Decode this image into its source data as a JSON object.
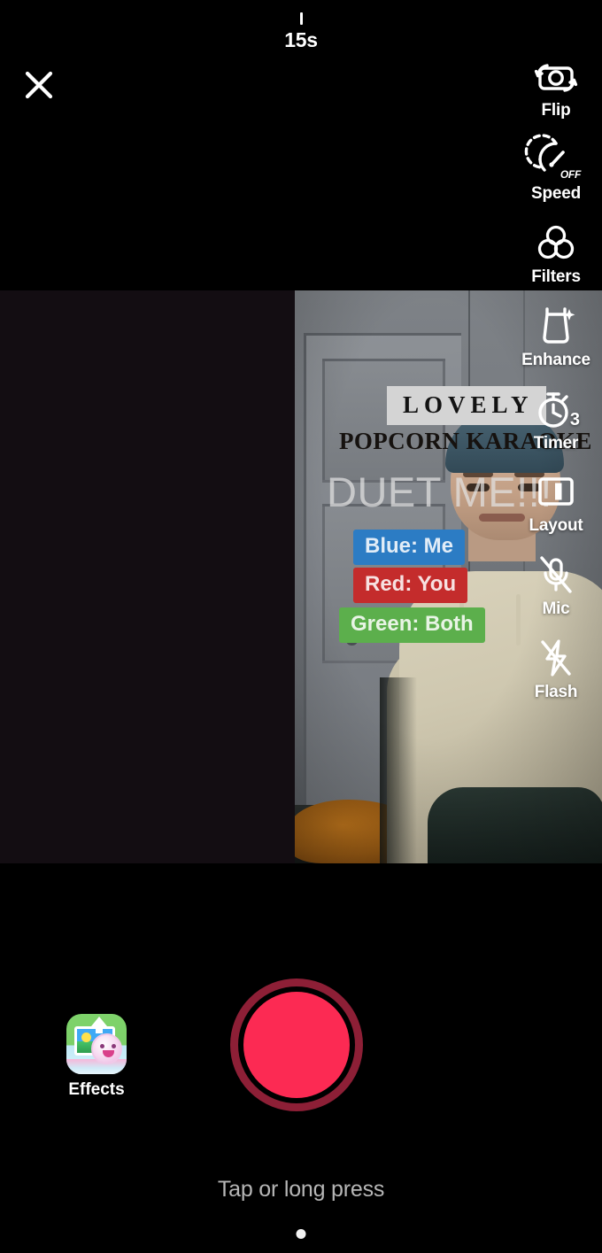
{
  "app": {
    "screen_name": "TikTok Camera - Duet Recording",
    "background_color": "#000000",
    "accent_color": "#fc2a53"
  },
  "top_bar": {
    "close_icon": "close-icon",
    "duration": {
      "label": "15s",
      "tick_marker": "|"
    }
  },
  "duet": {
    "left_panel": {
      "state": "empty",
      "background_color": "#130d12"
    },
    "right_panel": {
      "description": "Video preview of person in beige hoodie and blue beanie sitting in front of a white door",
      "overlays": [
        {
          "id": "lovely",
          "text": "LOVELY",
          "style": "serif-banner",
          "bg_color": "#d4d4d4",
          "text_color": "#121212"
        },
        {
          "id": "popcorn-karaoke",
          "text": "POPCORN KARAOKE",
          "style": "serif-heading",
          "text_color": "#16120f"
        },
        {
          "id": "duet-me",
          "text": "DUET ME!!!",
          "style": "large-outline",
          "text_color": "#e2e2e2"
        },
        {
          "id": "chip-blue",
          "text": "Blue: Me",
          "bg_color": "#2c7cc4",
          "text_color": "#ffffff"
        },
        {
          "id": "chip-red",
          "text": "Red: You",
          "bg_color": "#c42c2c",
          "text_color": "#ffffff"
        },
        {
          "id": "chip-green",
          "text": "Green: Both",
          "bg_color": "#5caf4c",
          "text_color": "#ffffff"
        }
      ]
    }
  },
  "tools": [
    {
      "id": "flip",
      "label": "Flip",
      "icon": "camera-flip-icon",
      "badge": ""
    },
    {
      "id": "speed",
      "label": "Speed",
      "icon": "speedometer-icon",
      "badge": "OFF"
    },
    {
      "id": "filters",
      "label": "Filters",
      "icon": "filters-icon",
      "badge": ""
    },
    {
      "id": "enhance",
      "label": "Enhance",
      "icon": "enhance-icon",
      "badge": ""
    },
    {
      "id": "timer",
      "label": "Timer",
      "icon": "timer-icon",
      "badge": "3"
    },
    {
      "id": "layout",
      "label": "Layout",
      "icon": "layout-icon",
      "badge": ""
    },
    {
      "id": "mic",
      "label": "Mic",
      "icon": "mic-muted-icon",
      "badge": ""
    },
    {
      "id": "flash",
      "label": "Flash",
      "icon": "flash-off-icon",
      "badge": ""
    }
  ],
  "bottom_bar": {
    "effects": {
      "label": "Effects",
      "icon": "effects-thumbnail-icon"
    },
    "record": {
      "name": "record-button",
      "core_color": "#fc2a53",
      "ring_color": "#8d1f36"
    },
    "hint": "Tap or long press",
    "home_indicator": "home-indicator-dot"
  }
}
